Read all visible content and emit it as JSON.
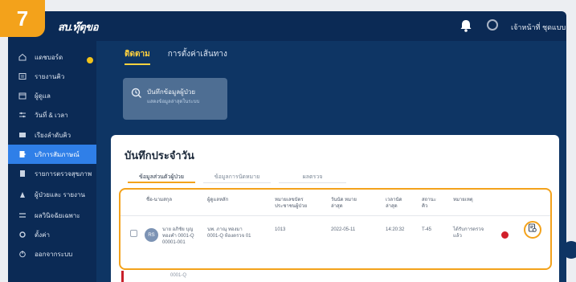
{
  "step": "7",
  "header": {
    "brand": "สบ.ทุ๊ตุขอ",
    "user_name": "เจ้าหน้าที่ ชุดแบบ"
  },
  "sidebar": {
    "items": [
      {
        "label": "แดชบอร์ด",
        "icon": "home-icon"
      },
      {
        "label": "รายงานคิว",
        "icon": "list-icon"
      },
      {
        "label": "ผู้ดูแล",
        "icon": "calendar-icon"
      },
      {
        "label": "วันที่ & เวลา",
        "icon": "sliders-icon"
      },
      {
        "label": "เรียงลำดับคิว",
        "icon": "book-icon"
      },
      {
        "label": "บริการสัมภาษณ์",
        "icon": "user-icon"
      },
      {
        "label": "รายการตรวจสุขภาพ",
        "icon": "document-icon"
      },
      {
        "label": "ผู้ป่วยและ รายงาน",
        "icon": "chart-icon"
      },
      {
        "label": "ผลวินิจฉัยเฉพาะ",
        "icon": "settings-icon"
      },
      {
        "label": "ตั้งค่า",
        "icon": "gear-icon"
      },
      {
        "label": "ออกจากระบบ",
        "icon": "power-icon"
      }
    ],
    "active_index": 5
  },
  "tabs": [
    {
      "label": "ติดตาม"
    },
    {
      "label": "การตั้งค่าเส้นทาง"
    }
  ],
  "info_card": {
    "title": "บันทึกข้อมูลผู้ป่วย",
    "subtitle": "แสดงข้อมูลล่าสุดในระบบ"
  },
  "panel": {
    "title": "บันทึกประจำวัน",
    "subtabs": [
      {
        "label": "ข้อมูลส่วนตัวผู้ป่วย"
      },
      {
        "label": "ข้อมูลการนัดหมาย"
      },
      {
        "label": "ผลตรวจ"
      }
    ]
  },
  "table": {
    "columns": [
      "ชื่อ-นามสกุล",
      "ผู้ดูแลหลัก",
      "หมายเลขบัตรประชาชนผู้ป่วย",
      "วันนัด หมายล่าสุด",
      "เวลานัด ล่าสุด",
      "สถานะ คิว",
      "หมายเหตุ"
    ],
    "rows": [
      {
        "initials": "RS",
        "name": "นาย อภิชัย บุญ ทองคำ 0001-Q 00001-001",
        "caregiver": "นพ. ภาณุ ทองมา 0001-Q ห้องตรวจ 01",
        "patient_id": "1013",
        "date": "2022-05-11",
        "time": "14:20:32",
        "queue": "T-45",
        "note": "ได้รับการตรวจแล้ว"
      }
    ]
  },
  "bottom_cell": "0001-Q"
}
